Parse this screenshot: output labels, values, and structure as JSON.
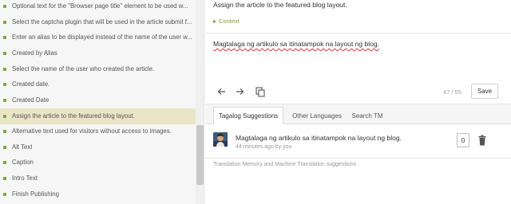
{
  "list": {
    "items": [
      {
        "label": "Optional text for the \"Browser page title\" element to be used w...",
        "active": false
      },
      {
        "label": "Select the captcha plugin that will be used in the article submit f...",
        "active": false
      },
      {
        "label": "Enter an alias to be displayed instead of the name of the user w...",
        "active": false
      },
      {
        "label": "Created by Alias",
        "active": false
      },
      {
        "label": "Select the name of the user who created the article.",
        "active": false
      },
      {
        "label": "Created date.",
        "active": false
      },
      {
        "label": "Created Date",
        "active": false
      },
      {
        "label": "Assign the article to the featured blog layout.",
        "active": true
      },
      {
        "label": "Alternative text used for visitors without access to images.",
        "active": false
      },
      {
        "label": "Alt Text",
        "active": false
      },
      {
        "label": "Caption",
        "active": false
      },
      {
        "label": "Intro Text",
        "active": false
      },
      {
        "label": "Finish Publishing",
        "active": false
      }
    ]
  },
  "detail": {
    "source_text": "Assign the article to the featured blog layout.",
    "context_label": "Context",
    "translation": "Magtalaga ng artikulo sa itinatampok na layout ng blog.",
    "counter": "47 / 55",
    "save_label": "Save"
  },
  "tabs": [
    "Tagalog Suggestions",
    "Other Languages",
    "Search TM"
  ],
  "suggestion": {
    "text": "Magtalaga ng artikulo sa itinatampok na layout ng blog.",
    "meta": "44 minutes ago by you",
    "count": "0"
  },
  "footer_note": "Translation Memory and Machine Translation suggestions",
  "colors": {
    "accent_green": "#75a93f",
    "context_green": "#8a9b2e",
    "active_row": "#ebe5c8"
  }
}
